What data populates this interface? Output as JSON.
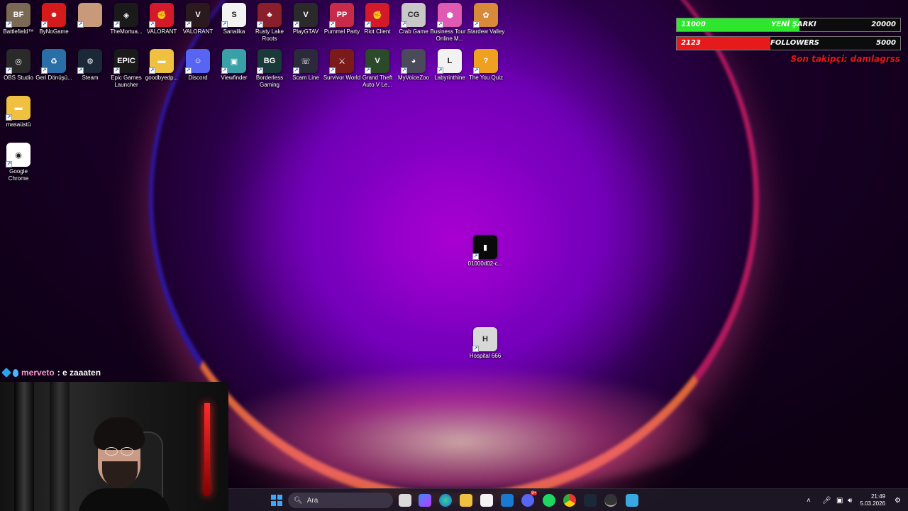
{
  "desktop": {
    "icons": [
      {
        "label": "Battlefield™",
        "color": "#7a6a55",
        "glyph": "BF"
      },
      {
        "label": "ByNoGame",
        "color": "#d41a1a",
        "glyph": "☻"
      },
      {
        "label": "",
        "color": "#c89a7a",
        "glyph": ""
      },
      {
        "label": "TheMortua...",
        "color": "#1a1a1a",
        "glyph": "◈"
      },
      {
        "label": "VALORANT",
        "color": "#d41a2a",
        "glyph": "✊"
      },
      {
        "label": "VALORANT",
        "color": "#2a1a1e",
        "glyph": "V"
      },
      {
        "label": "Sanalika",
        "color": "#f2f2f2",
        "glyph": "S"
      },
      {
        "label": "Rusty Lake Roots",
        "color": "#8a1e2a",
        "glyph": "♣"
      },
      {
        "label": "PlayGTAV",
        "color": "#2a2a2a",
        "glyph": "V"
      },
      {
        "label": "Pummel Party",
        "color": "#c82a4a",
        "glyph": "PP"
      },
      {
        "label": "Riot Client",
        "color": "#d41a2a",
        "glyph": "✊"
      },
      {
        "label": "Crab Game",
        "color": "#c8c8c8",
        "glyph": "CG"
      },
      {
        "label": "Business Tour - Online M...",
        "color": "#e05ab4",
        "glyph": "⬢"
      },
      {
        "label": "Stardew Valley",
        "color": "#d88a3a",
        "glyph": "✿"
      },
      {
        "label": "OBS Studio",
        "color": "#2a2a2a",
        "glyph": "◎"
      },
      {
        "label": "Geri Dönüşü...",
        "color": "#2a6ea8",
        "glyph": "♻"
      },
      {
        "label": "Steam",
        "color": "#1b2838",
        "glyph": "⚙"
      },
      {
        "label": "Epic Games Launcher",
        "color": "#1a1a1a",
        "glyph": "EPIC"
      },
      {
        "label": "goodbyedp...",
        "color": "#f0c040",
        "glyph": "▬"
      },
      {
        "label": "Discord",
        "color": "#5865f2",
        "glyph": "☺"
      },
      {
        "label": "Viewfinder",
        "color": "#3aa0a8",
        "glyph": "▣"
      },
      {
        "label": "Borderless Gaming",
        "color": "#1a3a3a",
        "glyph": "BG"
      },
      {
        "label": "Scam Line",
        "color": "#2a2a3a",
        "glyph": "☏"
      },
      {
        "label": "Survivor World",
        "color": "#7a1a1a",
        "glyph": "⚔"
      },
      {
        "label": "Grand Theft Auto V Le...",
        "color": "#2a4a2a",
        "glyph": "V"
      },
      {
        "label": "MyVoiceZoo",
        "color": "#4a4a5a",
        "glyph": "◕"
      },
      {
        "label": "Labyrinthine",
        "color": "#f2f2f2",
        "glyph": "L"
      },
      {
        "label": "The You Quiz",
        "color": "#f0a020",
        "glyph": "?"
      },
      {
        "label": "masaüstü",
        "color": "#f0c040",
        "glyph": "▬"
      },
      {
        "label": "Google Chrome",
        "color": "#ffffff",
        "glyph": "◉"
      },
      {
        "label": "01000d02-c...",
        "color": "#0a0a0a",
        "glyph": "▮"
      },
      {
        "label": "Hospital 666",
        "color": "#d8d8d8",
        "glyph": "H"
      }
    ]
  },
  "overlay": {
    "goal1": {
      "current": "11000",
      "name": "YENİ ŞARKI",
      "max": "20000",
      "progress": 0.55,
      "color": "#2ee62e"
    },
    "goal2": {
      "current": "2123",
      "name": "FOLLOWERS",
      "max": "5000",
      "progress": 0.42,
      "color": "#e61a1a"
    },
    "last_follower": "Son takipçi: damlagrss"
  },
  "chat": {
    "user": "merveto",
    "message": ": e zaaaten"
  },
  "taskbar": {
    "search_placeholder": "Ara",
    "time": "21:49",
    "date": "5.03.2026",
    "notification_badge": "9+"
  }
}
